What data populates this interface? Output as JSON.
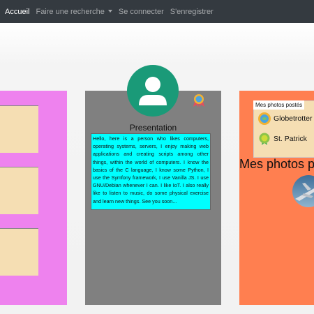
{
  "nav": {
    "home": "Accueil",
    "search": "Faire une recherche",
    "login": "Se connecter",
    "register": "S'enregistrer"
  },
  "profile": {
    "section_title": "Presentation",
    "bio": "Hello, here is a person who likes computers, operating systems, servers, I enjoy making web applications and creating scripts among other things, within the world of computers. I know the basics of the C language, I know some Python, I use the Symfony framework, I use Vanilla JS. I use GNU/Debian whenever I can. I like IoT. I also really like to listen to music, do some physical exercise and learn new things. See you soon..."
  },
  "badges": {
    "title": "Mes photos postés",
    "items": [
      {
        "label": "Globetrotter",
        "icon": "globe-medal-icon"
      },
      {
        "label": "St. Patrick",
        "icon": "clover-medal-icon"
      }
    ]
  },
  "photos": {
    "heading": "Mes photos po"
  },
  "colors": {
    "navbar": "#343a40",
    "left_column": "#ee82ee",
    "middle_column": "#808080",
    "right_column": "#ff7f50",
    "card": "#f5deb3",
    "bio_background": "#00ffff",
    "avatar": "#1a9a78"
  }
}
